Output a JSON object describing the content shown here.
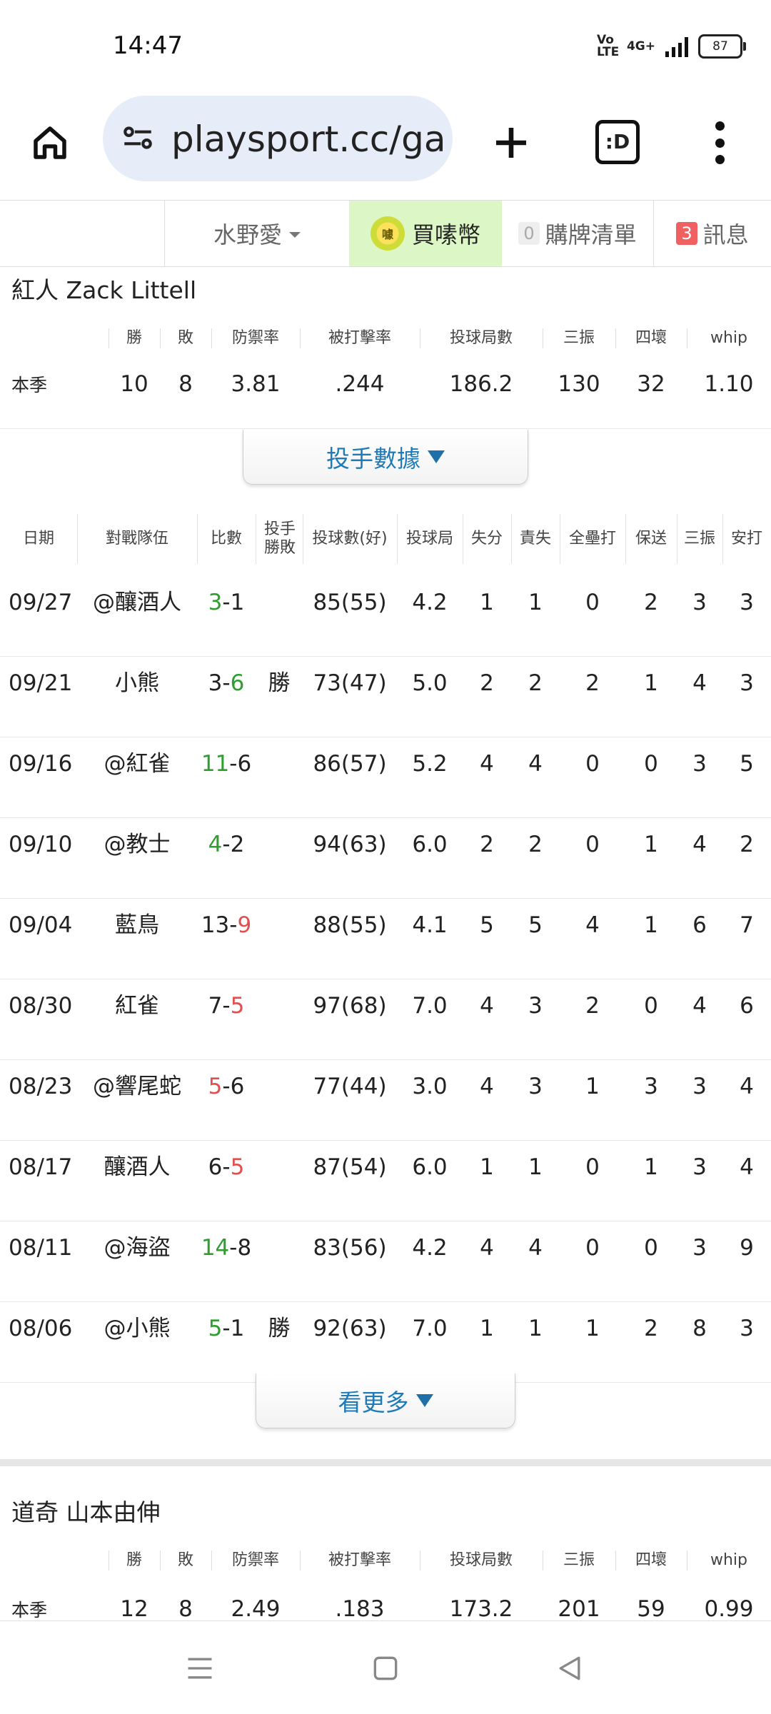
{
  "status_bar": {
    "time": "14:47",
    "volte": "Vo LTE",
    "network": "4G+",
    "battery": "87"
  },
  "browser": {
    "url": "playsport.cc/gam",
    "tabs_label": ":D"
  },
  "site_header": {
    "user_name": "水野愛",
    "buy_coin": "買嗉幣",
    "coin_icon_text": "噱",
    "purchase_count": "0",
    "purchase_list": "購牌清單",
    "message_count": "3",
    "messages": "訊息"
  },
  "season_headers": [
    "勝",
    "敗",
    "防禦率",
    "被打擊率",
    "投球局數",
    "三振",
    "四壞",
    "whip"
  ],
  "pitchers": [
    {
      "name": "紅人 Zack Littell",
      "season_label": "本季",
      "stats": [
        "10",
        "8",
        "3.81",
        ".244",
        "186.2",
        "130",
        "32",
        "1.10"
      ]
    },
    {
      "name": "道奇 山本由伸",
      "season_label": "本季",
      "stats": [
        "12",
        "8",
        "2.49",
        ".183",
        "173.2",
        "201",
        "59",
        "0.99"
      ]
    }
  ],
  "pitcher_data_button": "投手數據",
  "log_headers": [
    "日期",
    "對戰隊伍",
    "比數",
    "投手勝敗",
    "投球數(好)",
    "投球局",
    "失分",
    "責失",
    "全壘打",
    "保送",
    "三振",
    "安打"
  ],
  "game_log": [
    {
      "date": "09/27",
      "opponent": "@釀酒人",
      "score_a": "3",
      "score_sep": "-",
      "score_b": "1",
      "a_class": "win",
      "b_class": "",
      "decision": "",
      "pitches": "85(55)",
      "ip": "4.2",
      "r": "1",
      "er": "1",
      "hr": "0",
      "bb": "2",
      "so": "3",
      "h": "3"
    },
    {
      "date": "09/21",
      "opponent": "小熊",
      "score_a": "3",
      "score_sep": "-",
      "score_b": "6",
      "a_class": "",
      "b_class": "win",
      "decision": "勝",
      "pitches": "73(47)",
      "ip": "5.0",
      "r": "2",
      "er": "2",
      "hr": "2",
      "bb": "1",
      "so": "4",
      "h": "3"
    },
    {
      "date": "09/16",
      "opponent": "@紅雀",
      "score_a": "11",
      "score_sep": "-",
      "score_b": "6",
      "a_class": "win",
      "b_class": "",
      "decision": "",
      "pitches": "86(57)",
      "ip": "5.2",
      "r": "4",
      "er": "4",
      "hr": "0",
      "bb": "0",
      "so": "3",
      "h": "5"
    },
    {
      "date": "09/10",
      "opponent": "@教士",
      "score_a": "4",
      "score_sep": "-",
      "score_b": "2",
      "a_class": "win",
      "b_class": "",
      "decision": "",
      "pitches": "94(63)",
      "ip": "6.0",
      "r": "2",
      "er": "2",
      "hr": "0",
      "bb": "1",
      "so": "4",
      "h": "2"
    },
    {
      "date": "09/04",
      "opponent": "藍鳥",
      "score_a": "13",
      "score_sep": "-",
      "score_b": "9",
      "a_class": "",
      "b_class": "loss",
      "decision": "",
      "pitches": "88(55)",
      "ip": "4.1",
      "r": "5",
      "er": "5",
      "hr": "4",
      "bb": "1",
      "so": "6",
      "h": "7"
    },
    {
      "date": "08/30",
      "opponent": "紅雀",
      "score_a": "7",
      "score_sep": "-",
      "score_b": "5",
      "a_class": "",
      "b_class": "loss",
      "decision": "",
      "pitches": "97(68)",
      "ip": "7.0",
      "r": "4",
      "er": "3",
      "hr": "2",
      "bb": "0",
      "so": "4",
      "h": "6"
    },
    {
      "date": "08/23",
      "opponent": "@響尾蛇",
      "score_a": "5",
      "score_sep": "-",
      "score_b": "6",
      "a_class": "loss",
      "b_class": "",
      "decision": "",
      "pitches": "77(44)",
      "ip": "3.0",
      "r": "4",
      "er": "3",
      "hr": "1",
      "bb": "3",
      "so": "3",
      "h": "4"
    },
    {
      "date": "08/17",
      "opponent": "釀酒人",
      "score_a": "6",
      "score_sep": "-",
      "score_b": "5",
      "a_class": "",
      "b_class": "loss",
      "decision": "",
      "pitches": "87(54)",
      "ip": "6.0",
      "r": "1",
      "er": "1",
      "hr": "0",
      "bb": "1",
      "so": "3",
      "h": "4"
    },
    {
      "date": "08/11",
      "opponent": "@海盜",
      "score_a": "14",
      "score_sep": "-",
      "score_b": "8",
      "a_class": "win",
      "b_class": "",
      "decision": "",
      "pitches": "83(56)",
      "ip": "4.2",
      "r": "4",
      "er": "4",
      "hr": "0",
      "bb": "0",
      "so": "3",
      "h": "9"
    },
    {
      "date": "08/06",
      "opponent": "@小熊",
      "score_a": "5",
      "score_sep": "-",
      "score_b": "1",
      "a_class": "win",
      "b_class": "",
      "decision": "勝",
      "pitches": "92(63)",
      "ip": "7.0",
      "r": "1",
      "er": "1",
      "hr": "1",
      "bb": "2",
      "so": "8",
      "h": "3"
    }
  ],
  "see_more_button": "看更多",
  "colors": {
    "win": "#2f9e2f",
    "loss": "#e05050",
    "link": "#1f7ab8",
    "coin_bg": "#dcf7c5"
  }
}
